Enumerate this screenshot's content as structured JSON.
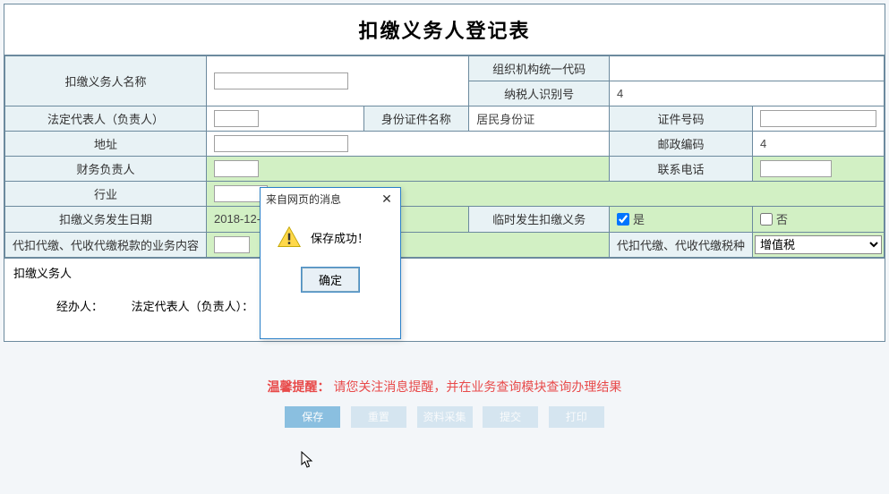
{
  "title": "扣缴义务人登记表",
  "labels": {
    "agent_name": "扣缴义务人名称",
    "org_code": "组织机构统一代码",
    "taxpayer_id": "纳税人识别号",
    "legal_rep": "法定代表人（负责人）",
    "id_type": "身份证件名称",
    "id_number": "证件号码",
    "address": "地址",
    "postcode": "邮政编码",
    "finance_officer": "财务负责人",
    "phone": "联系电话",
    "industry": "行业",
    "duty_date": "扣缴义务发生日期",
    "temp_duty": "临时发生扣缴义务",
    "yes": "是",
    "no": "否",
    "biz_content": "代扣代缴、代收代缴税款的业务内容",
    "tax_kind": "代扣代缴、代收代缴税种"
  },
  "values": {
    "agent_name": "",
    "org_code": "",
    "taxpayer_id": "4",
    "legal_rep": "",
    "id_type": "居民身份证",
    "id_number": "",
    "address": "",
    "postcode": "4",
    "finance_officer": "",
    "phone": "",
    "industry": "",
    "duty_date": "2018-12-05",
    "temp_yes": true,
    "temp_no": false,
    "tax_kind_selected": "增值税",
    "biz_content": ""
  },
  "signature": {
    "section_label": "扣缴义务人",
    "handler": "经办人：",
    "legal_rep": "法定代表人（负责人）："
  },
  "reminder": {
    "label": "温馨提醒：",
    "text": "请您关注消息提醒，并在业务查询模块查询办理结果"
  },
  "buttons": {
    "save": "保存",
    "reset": "重置",
    "collect": "资料采集",
    "submit": "提交",
    "print": "打印"
  },
  "dialog": {
    "title": "来自网页的消息",
    "message": "保存成功！",
    "ok": "确定"
  }
}
